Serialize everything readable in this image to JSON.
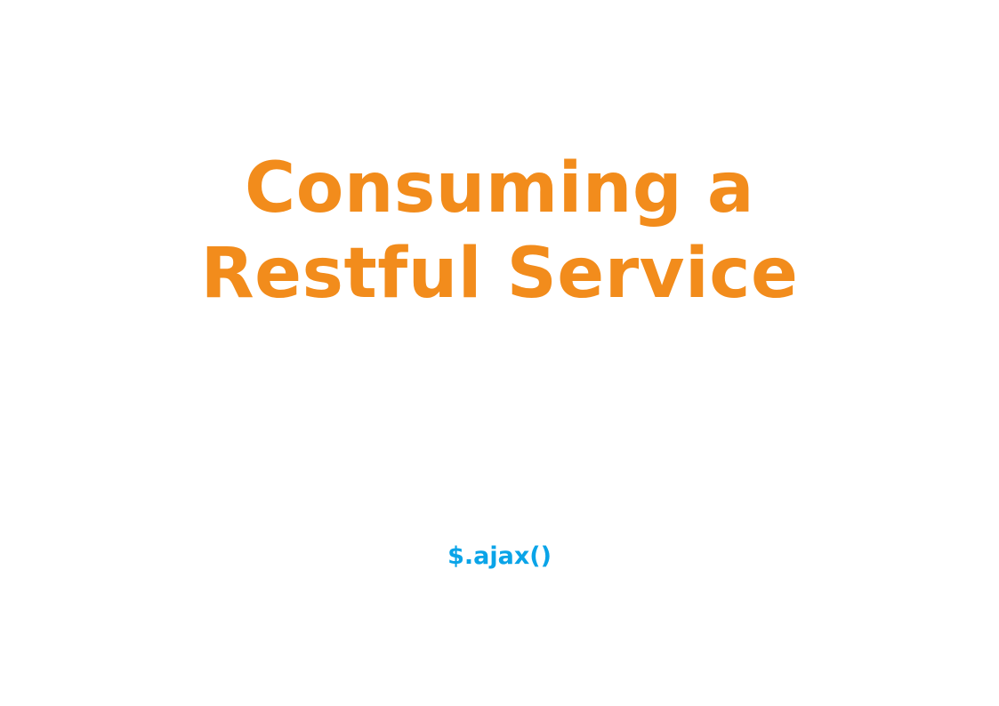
{
  "slide": {
    "title_lines": [
      "Consuming a",
      "Restful Service"
    ],
    "subtitle": "$.ajax()",
    "colors": {
      "background": "#ffffff",
      "title": "#f28c1c",
      "subtitle": "#0aa4e8"
    }
  }
}
